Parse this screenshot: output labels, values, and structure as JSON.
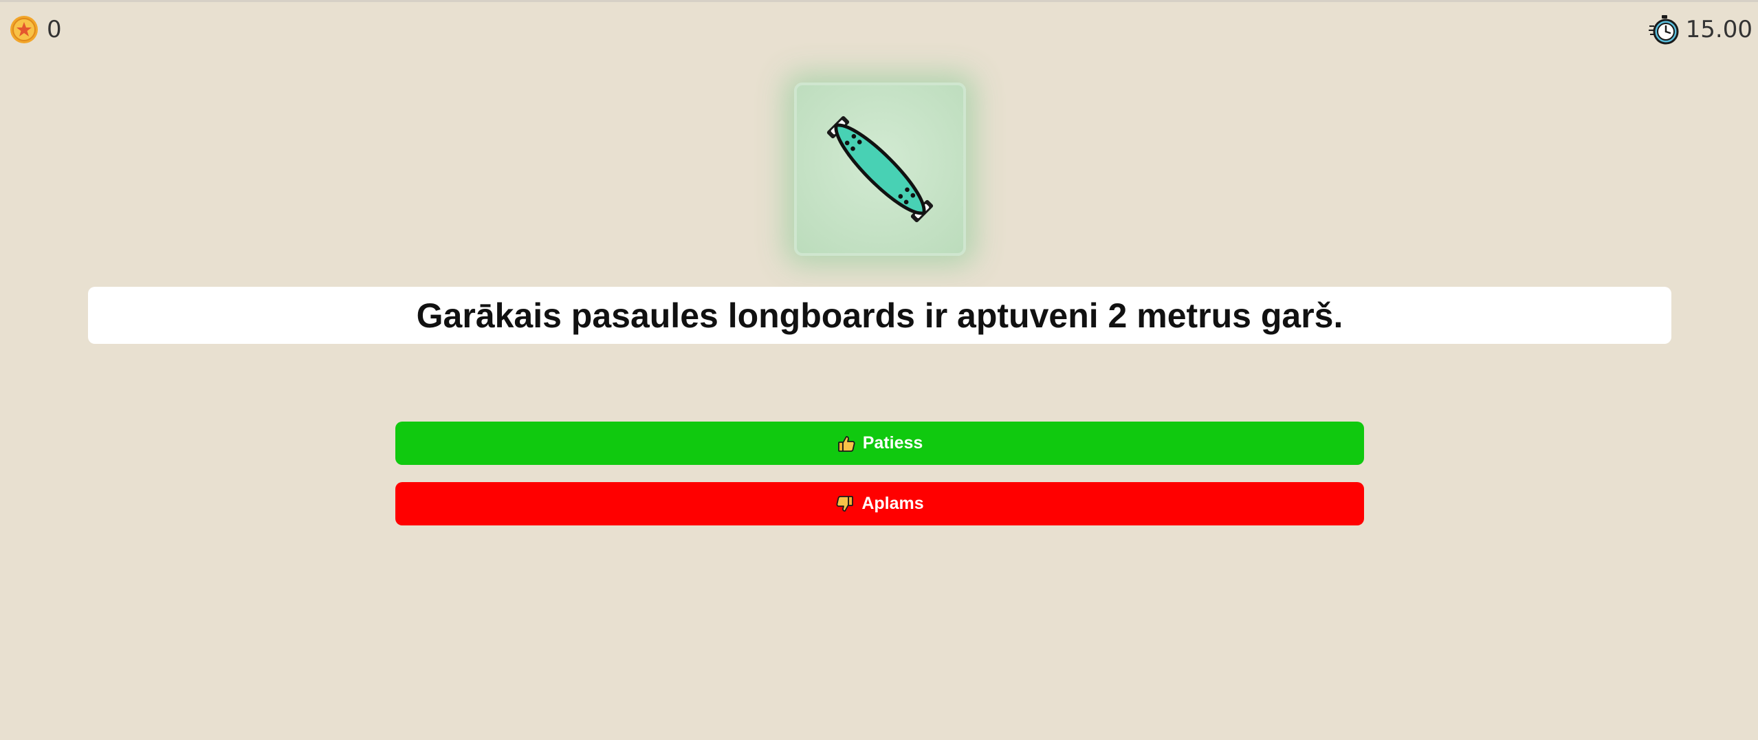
{
  "hud": {
    "score": "0",
    "timer": "15.00",
    "score_icon": "coin-star-icon",
    "timer_icon": "stopwatch-icon"
  },
  "question": {
    "image_icon": "longboard-icon",
    "statement": "Garākais pasaules longboards ir aptuveni 2 metrus garš."
  },
  "answers": {
    "true_label": "Patiess",
    "true_icon": "thumbs-up-icon",
    "false_label": "Aplams",
    "false_icon": "thumbs-down-icon"
  },
  "colors": {
    "background": "#e8e0d0",
    "true_button": "#10c90f",
    "false_button": "#ff0000",
    "card_bg": "#c8e4c8",
    "board_deck": "#48d1b4"
  }
}
